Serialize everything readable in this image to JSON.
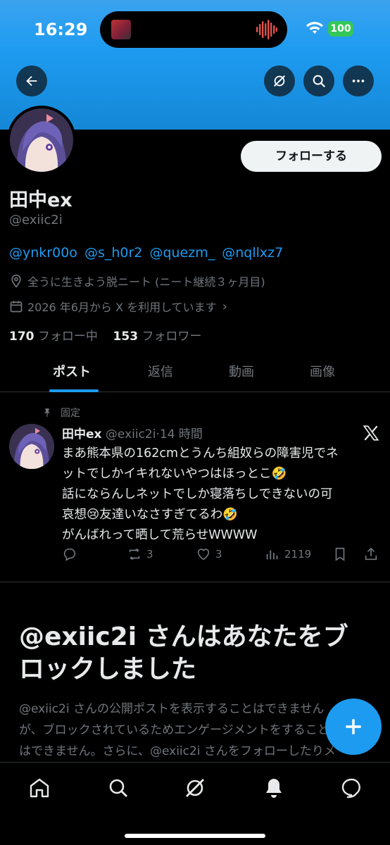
{
  "status_bar": {
    "time": "16:29",
    "battery": "100"
  },
  "header": {
    "back_icon": "arrow-left-icon",
    "grok_icon": "grok-icon",
    "search_icon": "search-icon",
    "more_icon": "more-icon"
  },
  "profile": {
    "follow_label": "フォローする",
    "display_name": "田中ex",
    "handle": "@exiic2i",
    "bio_mentions": [
      "@ynkr00o",
      "@s_h0r2",
      "@quezm_",
      "@nqllxz7"
    ],
    "location": "全うに生きよう脱ニート (ニート継続３ヶ月目)",
    "joined": "2026 年6月から X を利用しています",
    "following_count": "170",
    "following_label": "フォロー中",
    "followers_count": "153",
    "followers_label": "フォロワー"
  },
  "tabs": [
    "ポスト",
    "返信",
    "動画",
    "画像"
  ],
  "pinned_tweet": {
    "pinned_label": "固定",
    "name": "田中ex",
    "handle": "@exiic2i",
    "time": "14 時間",
    "lines": [
      "まあ熊本県の162cmとうんち組奴らの障害児でネ",
      "ットでしかイキれないやつはほっとこ🤣",
      "話にならんしネットでしか寝落ちしできないの可",
      "哀想😢友達いなさすぎてるわ🤣",
      "がんばれって晒して荒らせWWWW"
    ],
    "reposts": "3",
    "likes": "3",
    "views": "2119"
  },
  "blocked": {
    "title": "@exiic2i さんはあなたをブロックしました",
    "text_lines": [
      "@exiic2i さんの公開ポストを表示することはできませんが、ブロックされているためエンゲージメントをすることはできません。さらに、@exiic2i さんをフォローしたりメッセージを送信したりすることもできません。"
    ]
  },
  "bottom_nav": [
    "home-icon",
    "search-icon",
    "grok-icon",
    "notifications-icon",
    "messages-icon"
  ],
  "colors": {
    "accent": "#1d9bf0",
    "text": "#e7e9ea",
    "muted": "#71767b",
    "banner": "#1d9bf0"
  }
}
